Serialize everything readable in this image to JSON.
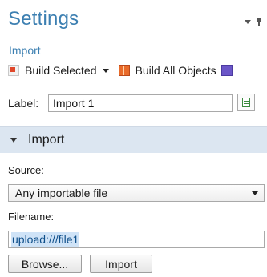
{
  "header": {
    "title": "Settings"
  },
  "node": {
    "name": "Import"
  },
  "toolbar": {
    "build_selected_label": "Build Selected",
    "build_all_label": "Build All Objects"
  },
  "label_field": {
    "label": "Label:",
    "value": "Import 1"
  },
  "section": {
    "title": "Import"
  },
  "source": {
    "label": "Source:",
    "selected": "Any importable file"
  },
  "filename": {
    "label": "Filename:",
    "value": "upload:///file1"
  },
  "buttons": {
    "browse": "Browse...",
    "import": "Import"
  },
  "colors": {
    "accent": "#3c7fb1",
    "section_bg": "#dce6f1",
    "selection_bg": "#cfe3f7"
  }
}
